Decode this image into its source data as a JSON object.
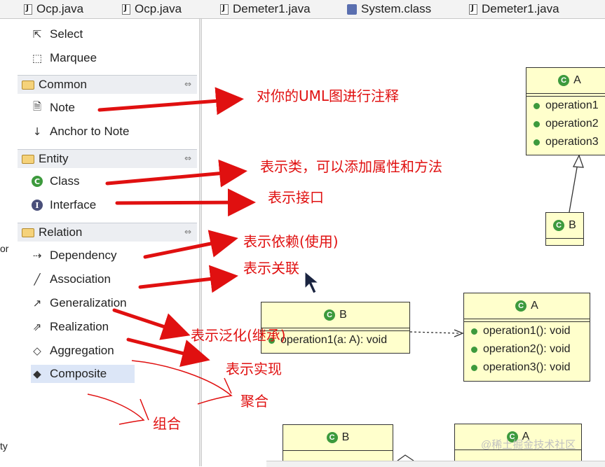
{
  "tabs": [
    "Ocp.java",
    "Ocp.java",
    "Demeter1.java",
    "System.class",
    "Demeter1.java"
  ],
  "left_strip": {
    "or": "or",
    "ty": "ty"
  },
  "palette": {
    "tools": {
      "select": "Select",
      "marquee": "Marquee"
    },
    "categories": {
      "common": {
        "label": "Common",
        "items": [
          "Note",
          "Anchor to Note"
        ]
      },
      "entity": {
        "label": "Entity",
        "items": [
          "Class",
          "Interface"
        ]
      },
      "relation": {
        "label": "Relation",
        "items": [
          "Dependency",
          "Association",
          "Generalization",
          "Realization",
          "Aggregation",
          "Composite"
        ]
      }
    },
    "selected": "Composite"
  },
  "diagram": {
    "class_a_top": {
      "name": "A",
      "ops": [
        "operation1",
        "operation2",
        "operation3"
      ]
    },
    "class_b_small": {
      "name": "B"
    },
    "class_b_mid": {
      "name": "B",
      "ops": [
        "operation1(a: A): void"
      ]
    },
    "class_a_mid": {
      "name": "A",
      "ops": [
        "operation1(): void",
        "operation2(): void",
        "operation3(): void"
      ]
    },
    "class_b_bottom": {
      "name": "B"
    },
    "class_a_bottom": {
      "name": "A"
    }
  },
  "annotations": {
    "note": "对你的UML图进行注释",
    "class": "表示类，可以添加属性和方法",
    "interface": "表示接口",
    "dependency": "表示依赖(使用)",
    "association": "表示关联",
    "generalization": "表示泛化(继承)",
    "realization": "表示实现",
    "aggregation": "聚合",
    "composite": "组合"
  },
  "watermark": "@稀土掘金技术社区",
  "colors": {
    "annotation": "#e01010",
    "uml_fill": "#ffffcc",
    "class_icon": "#3d9a3d"
  }
}
